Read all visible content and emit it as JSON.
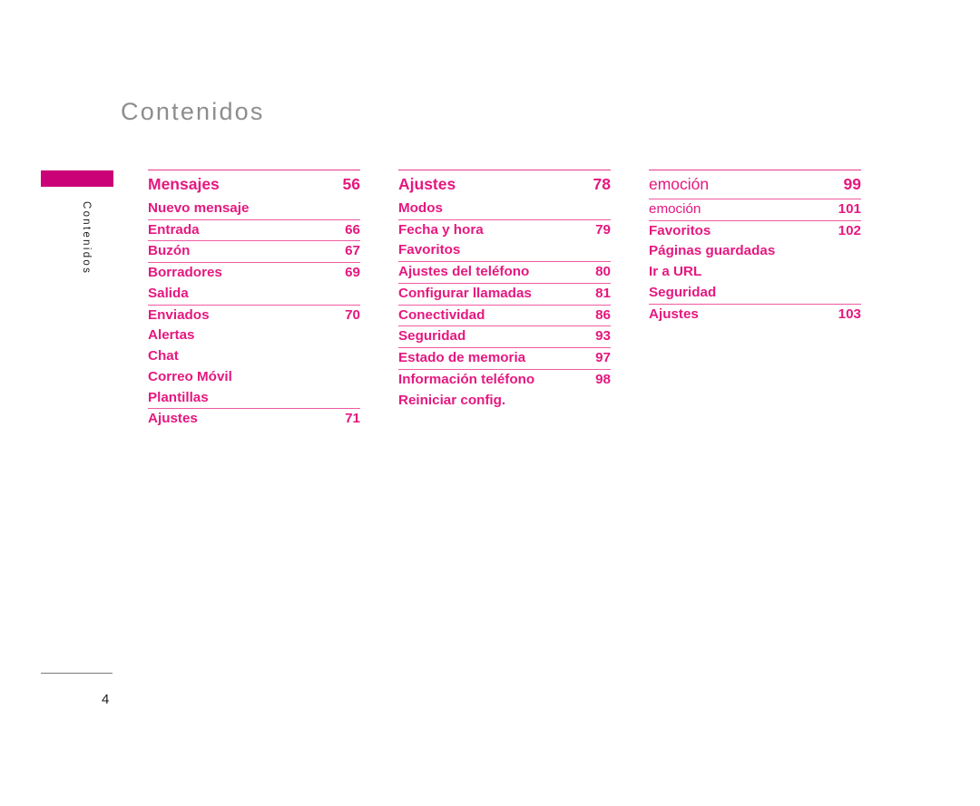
{
  "page": {
    "title": "Contenidos",
    "tab_label": "Contenidos",
    "page_number": "4",
    "accent_color": "#e5187f",
    "tab_color": "#cb0177",
    "title_color": "#8d8d8d",
    "rule_color": "#ef5ba1"
  },
  "columns": [
    {
      "id": "column-mensajes",
      "entries": [
        {
          "label": "Mensajes",
          "page": "56",
          "heading": true,
          "rule": false,
          "light": false
        },
        {
          "label": "Nuevo mensaje",
          "page": "",
          "heading": false,
          "rule": false,
          "light": false
        },
        {
          "label": "Entrada",
          "page": "66",
          "heading": false,
          "rule": true,
          "light": false
        },
        {
          "label": "Buzón",
          "page": "67",
          "heading": false,
          "rule": true,
          "light": false
        },
        {
          "label": "Borradores",
          "page": "69",
          "heading": false,
          "rule": true,
          "light": false
        },
        {
          "label": "Salida",
          "page": "",
          "heading": false,
          "rule": false,
          "light": false
        },
        {
          "label": "Enviados",
          "page": "70",
          "heading": false,
          "rule": true,
          "light": false
        },
        {
          "label": "Alertas",
          "page": "",
          "heading": false,
          "rule": false,
          "light": false
        },
        {
          "label": "Chat",
          "page": "",
          "heading": false,
          "rule": false,
          "light": false
        },
        {
          "label": "Correo Móvil",
          "page": "",
          "heading": false,
          "rule": false,
          "light": false
        },
        {
          "label": "Plantillas",
          "page": "",
          "heading": false,
          "rule": false,
          "light": false
        },
        {
          "label": "Ajustes",
          "page": "71",
          "heading": false,
          "rule": true,
          "light": false
        }
      ]
    },
    {
      "id": "column-ajustes",
      "entries": [
        {
          "label": "Ajustes",
          "page": "78",
          "heading": true,
          "rule": false,
          "light": false
        },
        {
          "label": "Modos",
          "page": "",
          "heading": false,
          "rule": false,
          "light": false
        },
        {
          "label": "Fecha y hora",
          "page": "79",
          "heading": false,
          "rule": true,
          "light": false
        },
        {
          "label": "Favoritos",
          "page": "",
          "heading": false,
          "rule": false,
          "light": false
        },
        {
          "label": "Ajustes del teléfono",
          "page": "80",
          "heading": false,
          "rule": true,
          "light": false
        },
        {
          "label": "Configurar llamadas",
          "page": "81",
          "heading": false,
          "rule": true,
          "light": false
        },
        {
          "label": "Conectividad",
          "page": "86",
          "heading": false,
          "rule": true,
          "light": false
        },
        {
          "label": "Seguridad",
          "page": "93",
          "heading": false,
          "rule": true,
          "light": false
        },
        {
          "label": "Estado de memoria",
          "page": "97",
          "heading": false,
          "rule": true,
          "light": false
        },
        {
          "label": "Información teléfono",
          "page": "98",
          "heading": false,
          "rule": true,
          "light": false
        },
        {
          "label": "Reiniciar config.",
          "page": "",
          "heading": false,
          "rule": false,
          "light": false
        }
      ]
    },
    {
      "id": "column-emocion",
      "entries": [
        {
          "label": "emoción",
          "page": "99",
          "heading": true,
          "rule": false,
          "light": true
        },
        {
          "label": "emoción",
          "page": "101",
          "heading": false,
          "rule": true,
          "light": true
        },
        {
          "label": "Favoritos",
          "page": "102",
          "heading": false,
          "rule": true,
          "light": false
        },
        {
          "label": "Páginas guardadas",
          "page": "",
          "heading": false,
          "rule": false,
          "light": false
        },
        {
          "label": "Ir a URL",
          "page": "",
          "heading": false,
          "rule": false,
          "light": false
        },
        {
          "label": "Seguridad",
          "page": "",
          "heading": false,
          "rule": false,
          "light": false
        },
        {
          "label": "Ajustes",
          "page": "103",
          "heading": false,
          "rule": true,
          "light": false
        }
      ]
    }
  ]
}
